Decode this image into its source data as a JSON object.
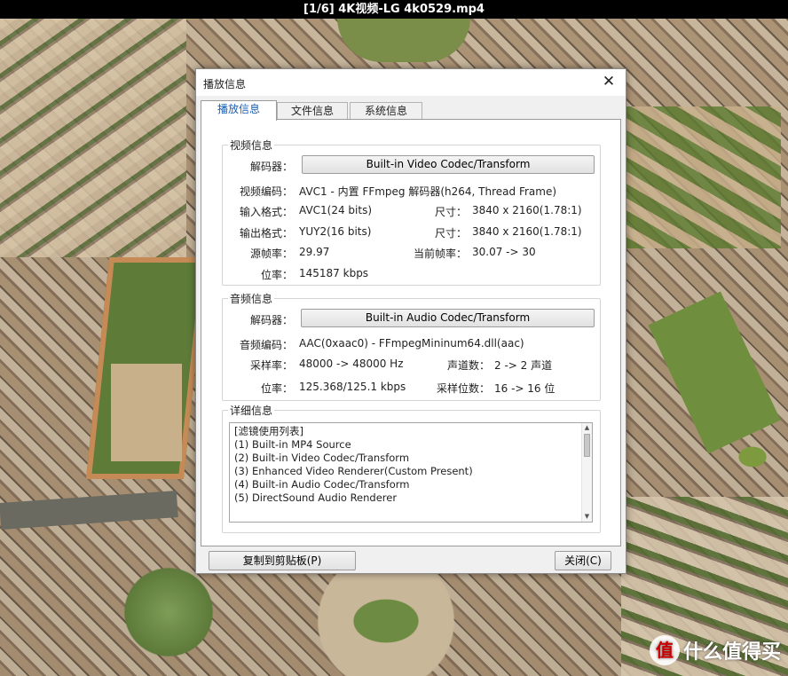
{
  "window_title": "[1/6] 4K视频-LG 4k0529.mp4",
  "dialog": {
    "title": "播放信息",
    "close_glyph": "✕",
    "tabs": [
      "播放信息",
      "文件信息",
      "系统信息"
    ],
    "active_tab": 0
  },
  "video": {
    "group_title": "视频信息",
    "decoder_label": "解码器：",
    "decoder_button": "Built-in Video Codec/Transform",
    "codec_label": "视频编码：",
    "codec_value": "AVC1 - 内置 FFmpeg 解码器(h264, Thread Frame)",
    "input_format_label": "输入格式：",
    "input_format_value": "AVC1(24 bits)",
    "input_size_label": "尺寸：",
    "input_size_value": "3840 x 2160(1.78:1)",
    "output_format_label": "输出格式：",
    "output_format_value": "YUY2(16 bits)",
    "output_size_label": "尺寸：",
    "output_size_value": "3840 x 2160(1.78:1)",
    "src_fps_label": "源帧率：",
    "src_fps_value": "29.97",
    "cur_fps_label": "当前帧率：",
    "cur_fps_value": "30.07 -> 30",
    "bitrate_label": "位率：",
    "bitrate_value": "145187 kbps"
  },
  "audio": {
    "group_title": "音频信息",
    "decoder_label": "解码器：",
    "decoder_button": "Built-in Audio Codec/Transform",
    "codec_label": "音频编码：",
    "codec_value": "AAC(0xaac0) - FFmpegMininum64.dll(aac)",
    "samplerate_label": "采样率：",
    "samplerate_value": "48000 -> 48000 Hz",
    "channels_label": "声道数：",
    "channels_value": "2 -> 2 声道",
    "bitrate_label": "位率：",
    "bitrate_value": "125.368/125.1 kbps",
    "bits_label": "采样位数：",
    "bits_value": "16 -> 16 位"
  },
  "details": {
    "group_title": "详细信息",
    "lines": [
      "[滤镜使用列表]",
      "(1) Built-in MP4 Source",
      "(2) Built-in Video Codec/Transform",
      "(3) Enhanced Video Renderer(Custom Present)",
      "(4) Built-in Audio Codec/Transform",
      "(5) DirectSound Audio Renderer"
    ]
  },
  "footer": {
    "copy_button": "复制到剪贴板(P)",
    "close_button": "关闭(C)"
  },
  "watermark": {
    "badge": "值",
    "text": "什么值得买"
  }
}
